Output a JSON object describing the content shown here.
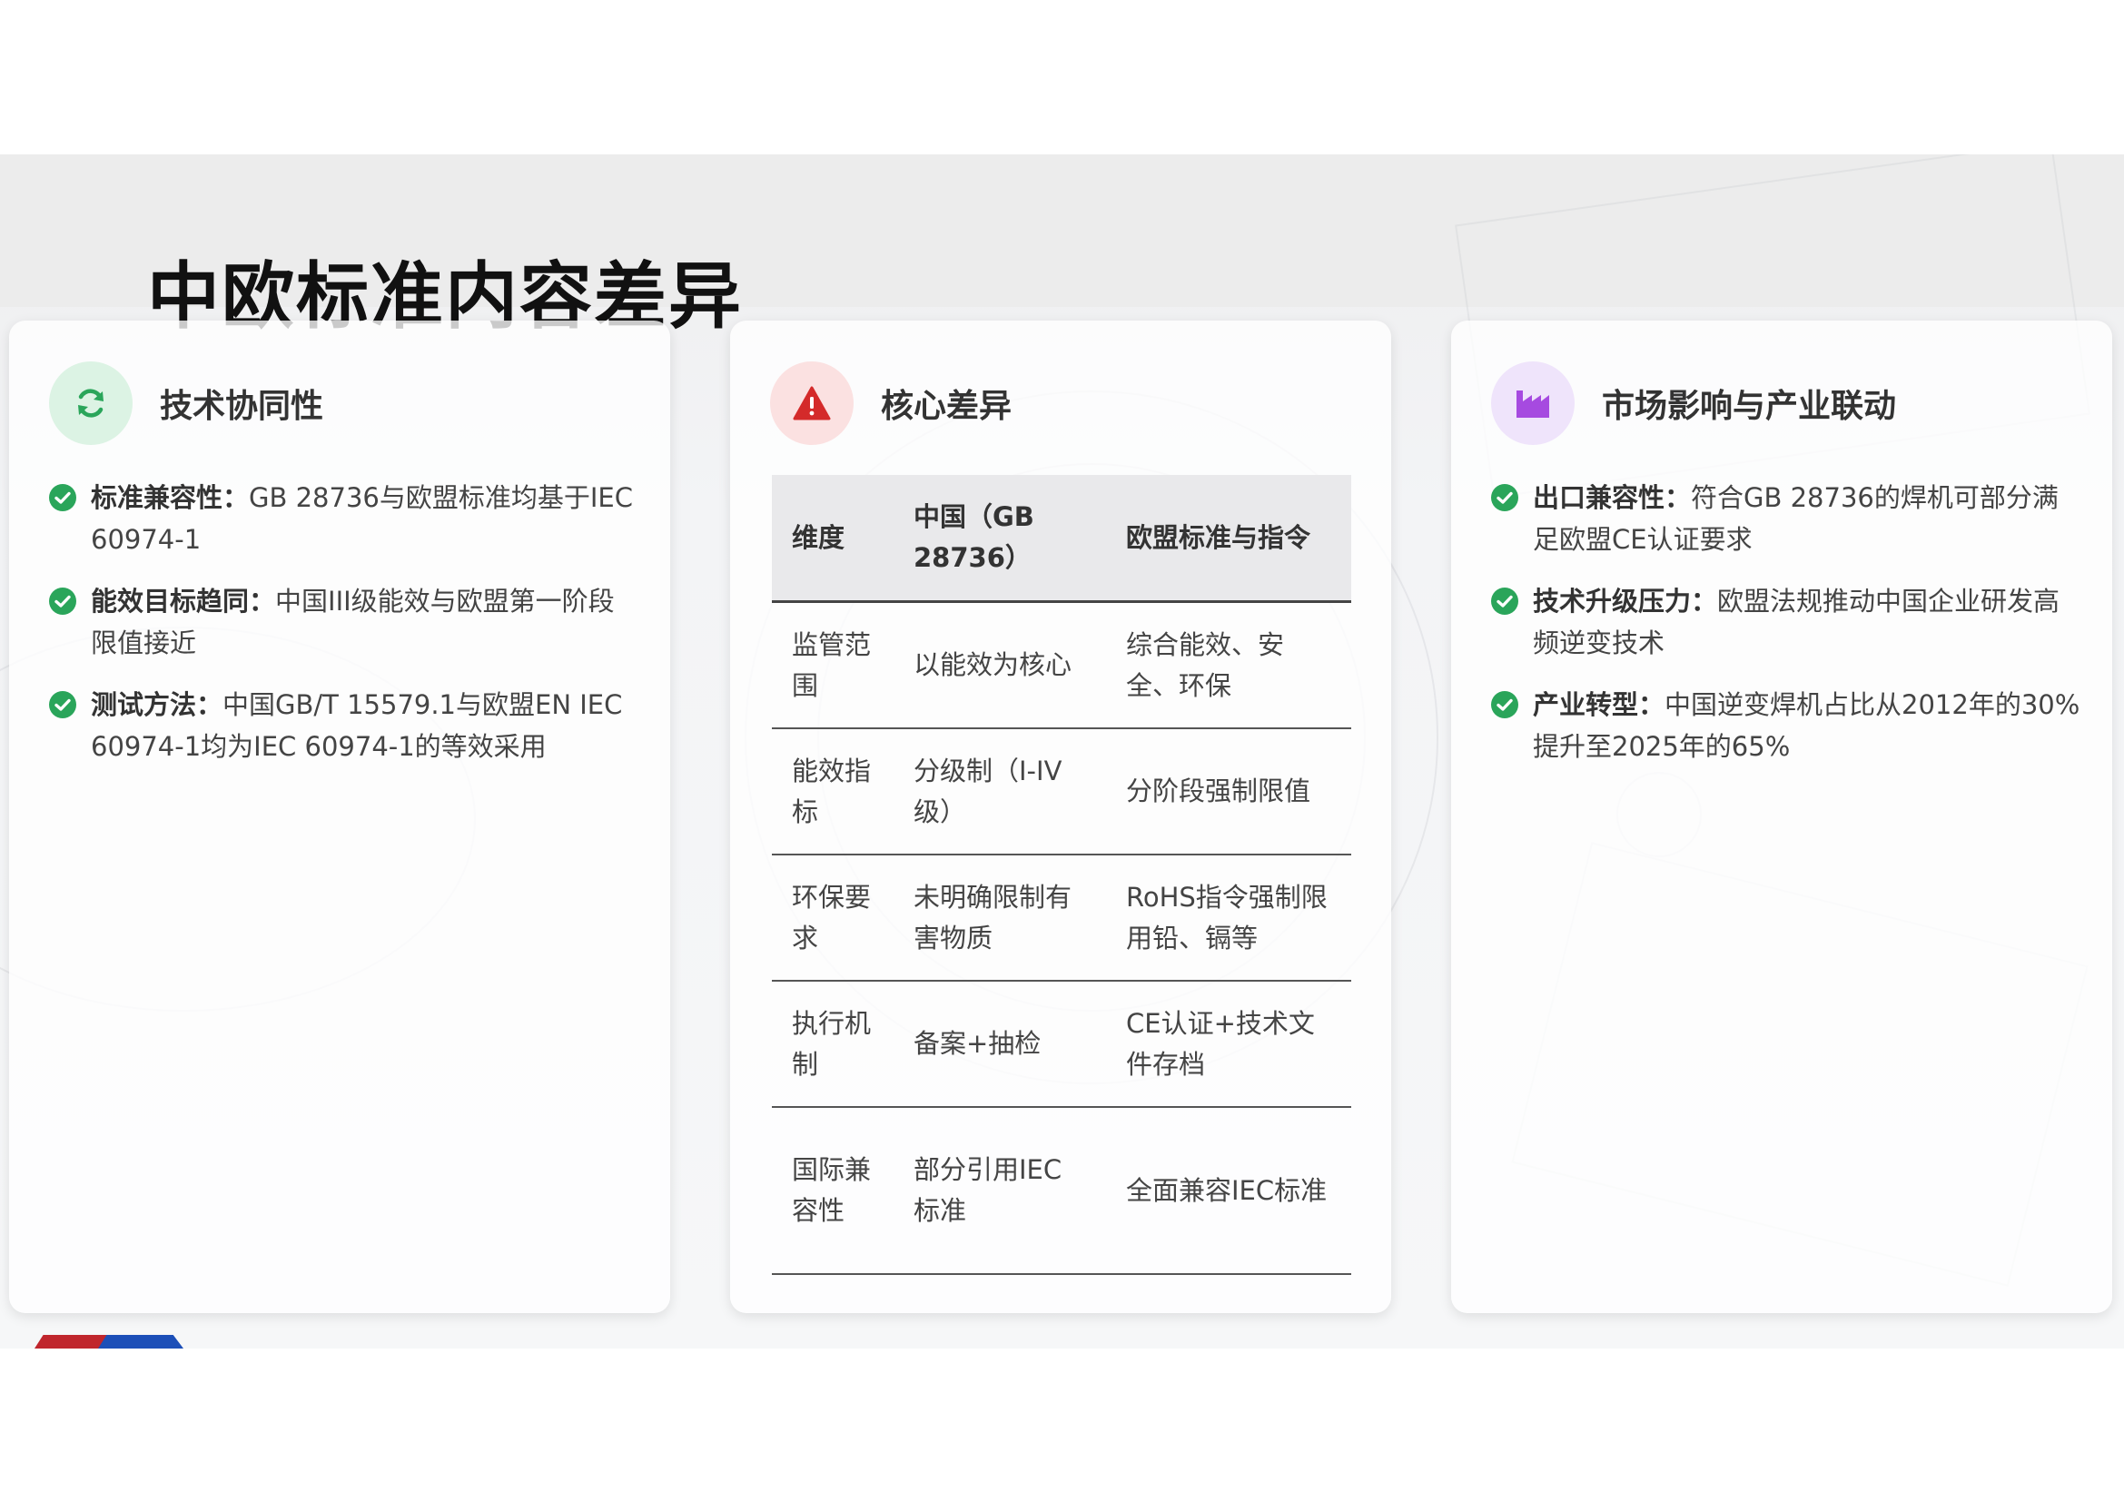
{
  "page": {
    "title": "中欧标准内容差异"
  },
  "colors": {
    "check_green": "#2aa55a",
    "warn_red": "#d42a2a",
    "factory_purple": "#a64ae0",
    "flag_red": "#c0262d",
    "flag_blue": "#1c4fb8"
  },
  "cards": [
    {
      "title": "技术协同性",
      "icon": "refresh-icon",
      "items": [
        {
          "label": "标准兼容性：",
          "text": "GB 28736与欧盟标准均基于IEC 60974-1"
        },
        {
          "label": "能效目标趋同：",
          "text": "中国III级能效与欧盟第一阶段限值接近"
        },
        {
          "label": "测试方法：",
          "text": "中国GB/T 15579.1与欧盟EN IEC 60974-1均为IEC 60974-1的等效采用"
        }
      ]
    },
    {
      "title": "核心差异",
      "icon": "warning-icon",
      "table": {
        "headers": [
          "维度",
          "中国（GB 28736）",
          "欧盟标准与指令"
        ],
        "rows": [
          [
            "监管范围",
            "以能效为核心",
            "综合能效、安全、环保"
          ],
          [
            "能效指标",
            "分级制（I-IV级）",
            "分阶段强制限值"
          ],
          [
            "环保要求",
            "未明确限制有害物质",
            "RoHS指令强制限用铅、镉等"
          ],
          [
            "执行机制",
            "备案+抽检",
            "CE认证+技术文件存档"
          ],
          [
            "国际兼容性",
            "部分引用IEC标准",
            "全面兼容IEC标准"
          ]
        ]
      }
    },
    {
      "title": "市场影响与产业联动",
      "icon": "factory-icon",
      "items": [
        {
          "label": "出口兼容性：",
          "text": "符合GB 28736的焊机可部分满足欧盟CE认证要求"
        },
        {
          "label": "技术升级压力：",
          "text": "欧盟法规推动中国企业研发高频逆变技术"
        },
        {
          "label": "产业转型：",
          "text": "中国逆变焊机占比从2012年的30%提升至2025年的65%"
        }
      ]
    }
  ]
}
